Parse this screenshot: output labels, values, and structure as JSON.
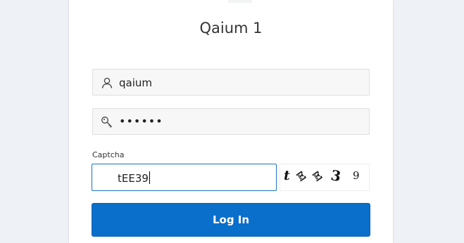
{
  "form": {
    "title": "Qaium 1",
    "username": {
      "value": "qaium",
      "icon": "user-icon"
    },
    "password": {
      "value": "••••••",
      "icon": "key-icon"
    },
    "captcha": {
      "label": "Captcha",
      "value": "tEE39",
      "image_text": "tEE39"
    },
    "login_label": "Log In"
  },
  "colors": {
    "page_bg": "#eef2f7",
    "accent": "#0a6fca",
    "focus_border": "#1a73c8",
    "field_bg": "#f7f7f7"
  }
}
